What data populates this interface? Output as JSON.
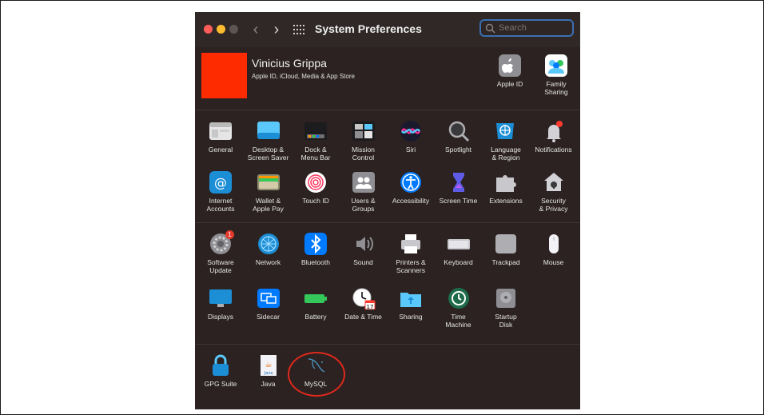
{
  "window": {
    "title": "System Preferences",
    "search_placeholder": "Search"
  },
  "user": {
    "name": "Vinicius Grippa",
    "subtitle": "Apple ID, iCloud, Media & App Store",
    "avatar_color": "#fe2a00"
  },
  "account_items": [
    {
      "label": "Apple ID",
      "icon": "apple-icon"
    },
    {
      "label": "Family\nSharing",
      "icon": "family-icon"
    }
  ],
  "section1": [
    {
      "label": "General",
      "icon": "general-icon"
    },
    {
      "label": "Desktop &\nScreen Saver",
      "icon": "desktop-icon"
    },
    {
      "label": "Dock &\nMenu Bar",
      "icon": "dock-icon"
    },
    {
      "label": "Mission\nControl",
      "icon": "mission-control-icon"
    },
    {
      "label": "Siri",
      "icon": "siri-icon"
    },
    {
      "label": "Spotlight",
      "icon": "spotlight-icon"
    },
    {
      "label": "Language\n& Region",
      "icon": "language-icon"
    },
    {
      "label": "Notifications",
      "icon": "notifications-icon"
    },
    {
      "label": "Internet\nAccounts",
      "icon": "internet-accounts-icon"
    },
    {
      "label": "Wallet &\nApple Pay",
      "icon": "wallet-icon"
    },
    {
      "label": "Touch ID",
      "icon": "touch-id-icon"
    },
    {
      "label": "Users &\nGroups",
      "icon": "users-icon"
    },
    {
      "label": "Accessibility",
      "icon": "accessibility-icon"
    },
    {
      "label": "Screen Time",
      "icon": "screen-time-icon"
    },
    {
      "label": "Extensions",
      "icon": "extensions-icon"
    },
    {
      "label": "Security\n& Privacy",
      "icon": "security-icon"
    }
  ],
  "section2": [
    {
      "label": "Software\nUpdate",
      "icon": "software-update-icon",
      "badge": "1"
    },
    {
      "label": "Network",
      "icon": "network-icon"
    },
    {
      "label": "Bluetooth",
      "icon": "bluetooth-icon"
    },
    {
      "label": "Sound",
      "icon": "sound-icon"
    },
    {
      "label": "Printers &\nScanners",
      "icon": "printer-icon"
    },
    {
      "label": "Keyboard",
      "icon": "keyboard-icon"
    },
    {
      "label": "Trackpad",
      "icon": "trackpad-icon"
    },
    {
      "label": "Mouse",
      "icon": "mouse-icon"
    },
    {
      "label": "Displays",
      "icon": "displays-icon"
    },
    {
      "label": "Sidecar",
      "icon": "sidecar-icon"
    },
    {
      "label": "Battery",
      "icon": "battery-icon"
    },
    {
      "label": "Date & Time",
      "icon": "date-time-icon"
    },
    {
      "label": "Sharing",
      "icon": "sharing-icon"
    },
    {
      "label": "Time\nMachine",
      "icon": "time-machine-icon"
    },
    {
      "label": "Startup\nDisk",
      "icon": "startup-disk-icon"
    }
  ],
  "section3": [
    {
      "label": "GPG Suite",
      "icon": "gpg-suite-icon"
    },
    {
      "label": "Java",
      "icon": "java-icon"
    },
    {
      "label": "MySQL",
      "icon": "mysql-icon"
    }
  ],
  "colors": {
    "window_bg": "#2b2221",
    "highlight_circle": "#e0291c",
    "search_focus": "#3a6fb0"
  }
}
